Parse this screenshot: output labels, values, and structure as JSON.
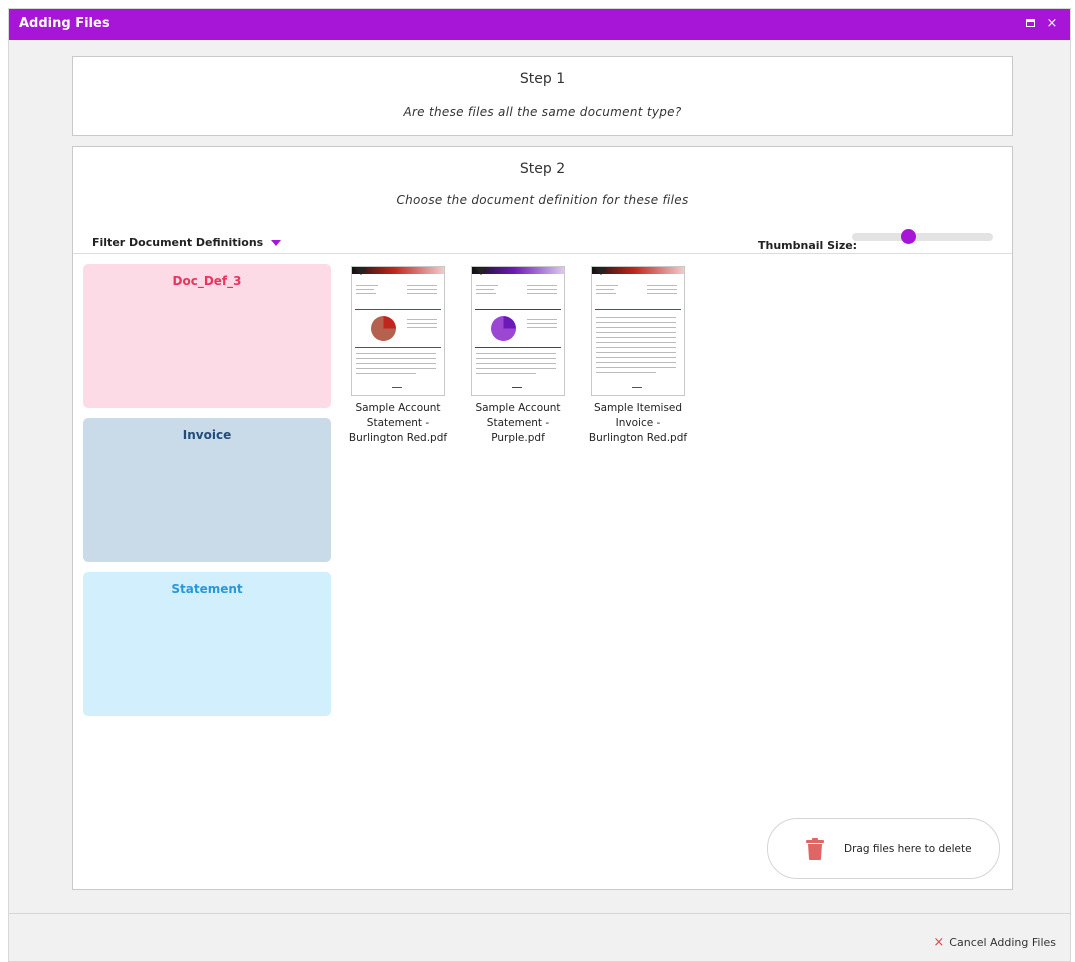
{
  "window": {
    "title": "Adding Files",
    "controls": {
      "maximize": "maximize-icon",
      "close": "×"
    },
    "accent_color": "#a715d6"
  },
  "step1": {
    "title": "Step 1",
    "question": "Are these files all the same document type?"
  },
  "step2": {
    "title": "Step 2",
    "instruction": "Choose the document definition for these files",
    "filter_label": "Filter Document Definitions",
    "thumbnail_size_label": "Thumbnail Size:",
    "thumbnail_size_value": 0.4
  },
  "definitions": [
    {
      "label": "Doc_Def_3",
      "bg": "#fcdbe6",
      "color": "#e8345e"
    },
    {
      "label": "Invoice",
      "bg": "#c9dae9",
      "color": "#214c7c"
    },
    {
      "label": "Statement",
      "bg": "#d2effd",
      "color": "#2a98d8"
    }
  ],
  "files": [
    {
      "name_line1": "Sample Account",
      "name_line2": "Statement -",
      "name_line3": "Burlington Red.pdf",
      "theme": "#c0261d",
      "pie": "#b5614f",
      "thumb_icon": "statement-red-thumbnail"
    },
    {
      "name_line1": "Sample Account",
      "name_line2": "Statement -",
      "name_line3": "Purple.pdf",
      "theme": "#6c1ab7",
      "pie": "#9b47d1",
      "thumb_icon": "statement-purple-thumbnail"
    },
    {
      "name_line1": "Sample Itemised",
      "name_line2": "Invoice -",
      "name_line3": "Burlington Red.pdf",
      "theme": "#c0261d",
      "pie": "",
      "thumb_icon": "invoice-red-thumbnail"
    }
  ],
  "delete_zone": {
    "label": "Drag files here to delete",
    "icon": "trash-icon",
    "icon_color": "#e06666"
  },
  "footer": {
    "cancel_label": "Cancel Adding Files",
    "cancel_icon": "×",
    "cancel_color": "#e0444f"
  }
}
